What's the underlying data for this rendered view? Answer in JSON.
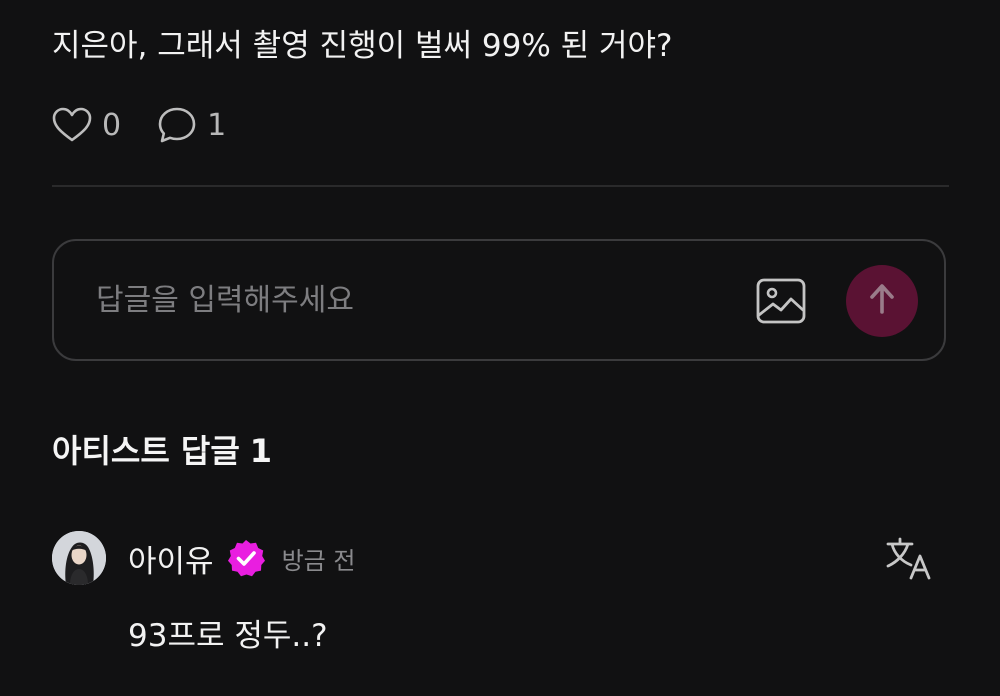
{
  "post": {
    "text": "지은아, 그래서 촬영 진행이 벌써 99% 된 거야?",
    "like_count": "0",
    "comment_count": "1"
  },
  "reply": {
    "placeholder": "답글을 입력해주세요"
  },
  "artist_replies": {
    "title": "아티스트 답글",
    "count": "1",
    "items": [
      {
        "author": "아이유",
        "timestamp": "방금 전",
        "text": "93프로 정두..?"
      }
    ]
  },
  "colors": {
    "background": "#111112",
    "send_button": "#5a1233",
    "verified_badge": "#e91ee0"
  },
  "icons": {
    "like": "heart-icon",
    "comment": "speech-bubble-icon",
    "image": "image-icon",
    "send": "arrow-up-icon",
    "verified": "verified-badge-icon",
    "translate": "translate-icon"
  }
}
